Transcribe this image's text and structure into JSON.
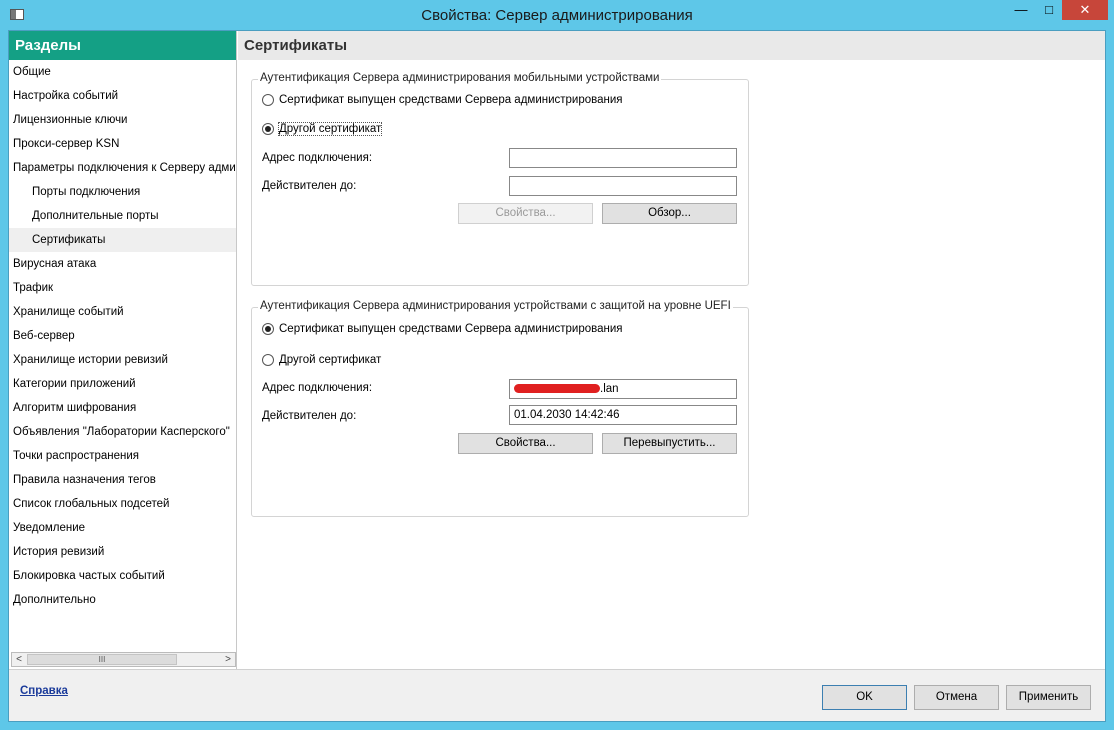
{
  "window": {
    "title": "Свойства: Сервер администрирования",
    "minimize": "—",
    "maximize": "□",
    "close": "✕"
  },
  "sidebar": {
    "title": "Разделы",
    "items": [
      {
        "label": "Общие"
      },
      {
        "label": "Настройка событий"
      },
      {
        "label": "Лицензионные ключи"
      },
      {
        "label": "Прокси-сервер KSN"
      },
      {
        "label": "Параметры подключения к Серверу администрирования"
      },
      {
        "label": "Порты подключения",
        "sub": true
      },
      {
        "label": "Дополнительные порты",
        "sub": true
      },
      {
        "label": "Сертификаты",
        "sub": true,
        "selected": true
      },
      {
        "label": "Вирусная атака"
      },
      {
        "label": "Трафик"
      },
      {
        "label": "Хранилище событий"
      },
      {
        "label": "Веб-сервер"
      },
      {
        "label": "Хранилище истории ревизий"
      },
      {
        "label": "Категории приложений"
      },
      {
        "label": "Алгоритм шифрования"
      },
      {
        "label": "Объявления \"Лаборатории Касперского\""
      },
      {
        "label": "Точки распространения"
      },
      {
        "label": "Правила назначения тегов"
      },
      {
        "label": "Список глобальных подсетей"
      },
      {
        "label": "Уведомление"
      },
      {
        "label": "История ревизий"
      },
      {
        "label": "Блокировка частых событий"
      },
      {
        "label": "Дополнительно"
      }
    ],
    "scroll_left": "<",
    "scroll_right": ">",
    "scroll_grip": "III"
  },
  "main": {
    "title": "Сертификаты",
    "group1": {
      "legend": "Аутентификация Сервера администрирования мобильными устройствами",
      "radio1": "Сертификат выпущен средствами Сервера администрирования",
      "radio2": "Другой сертификат",
      "selected": 2,
      "address_label": "Адрес подключения:",
      "address_value": "",
      "valid_label": "Действителен до:",
      "valid_value": "",
      "props_button": "Свойства...",
      "browse_button": "Обзор..."
    },
    "group2": {
      "legend": "Аутентификация Сервера администрирования устройствами с защитой на уровне UEFI",
      "radio1": "Сертификат выпущен средствами Сервера администрирования",
      "radio2": "Другой сертификат",
      "selected": 1,
      "address_label": "Адрес подключения:",
      "address_suffix": ".lan",
      "valid_label": "Действителен до:",
      "valid_value": "01.04.2030 14:42:46",
      "props_button": "Свойства...",
      "reissue_button": "Перевыпустить..."
    }
  },
  "footer": {
    "help": "Справка",
    "ok": "OK",
    "cancel": "Отмена",
    "apply": "Применить"
  }
}
